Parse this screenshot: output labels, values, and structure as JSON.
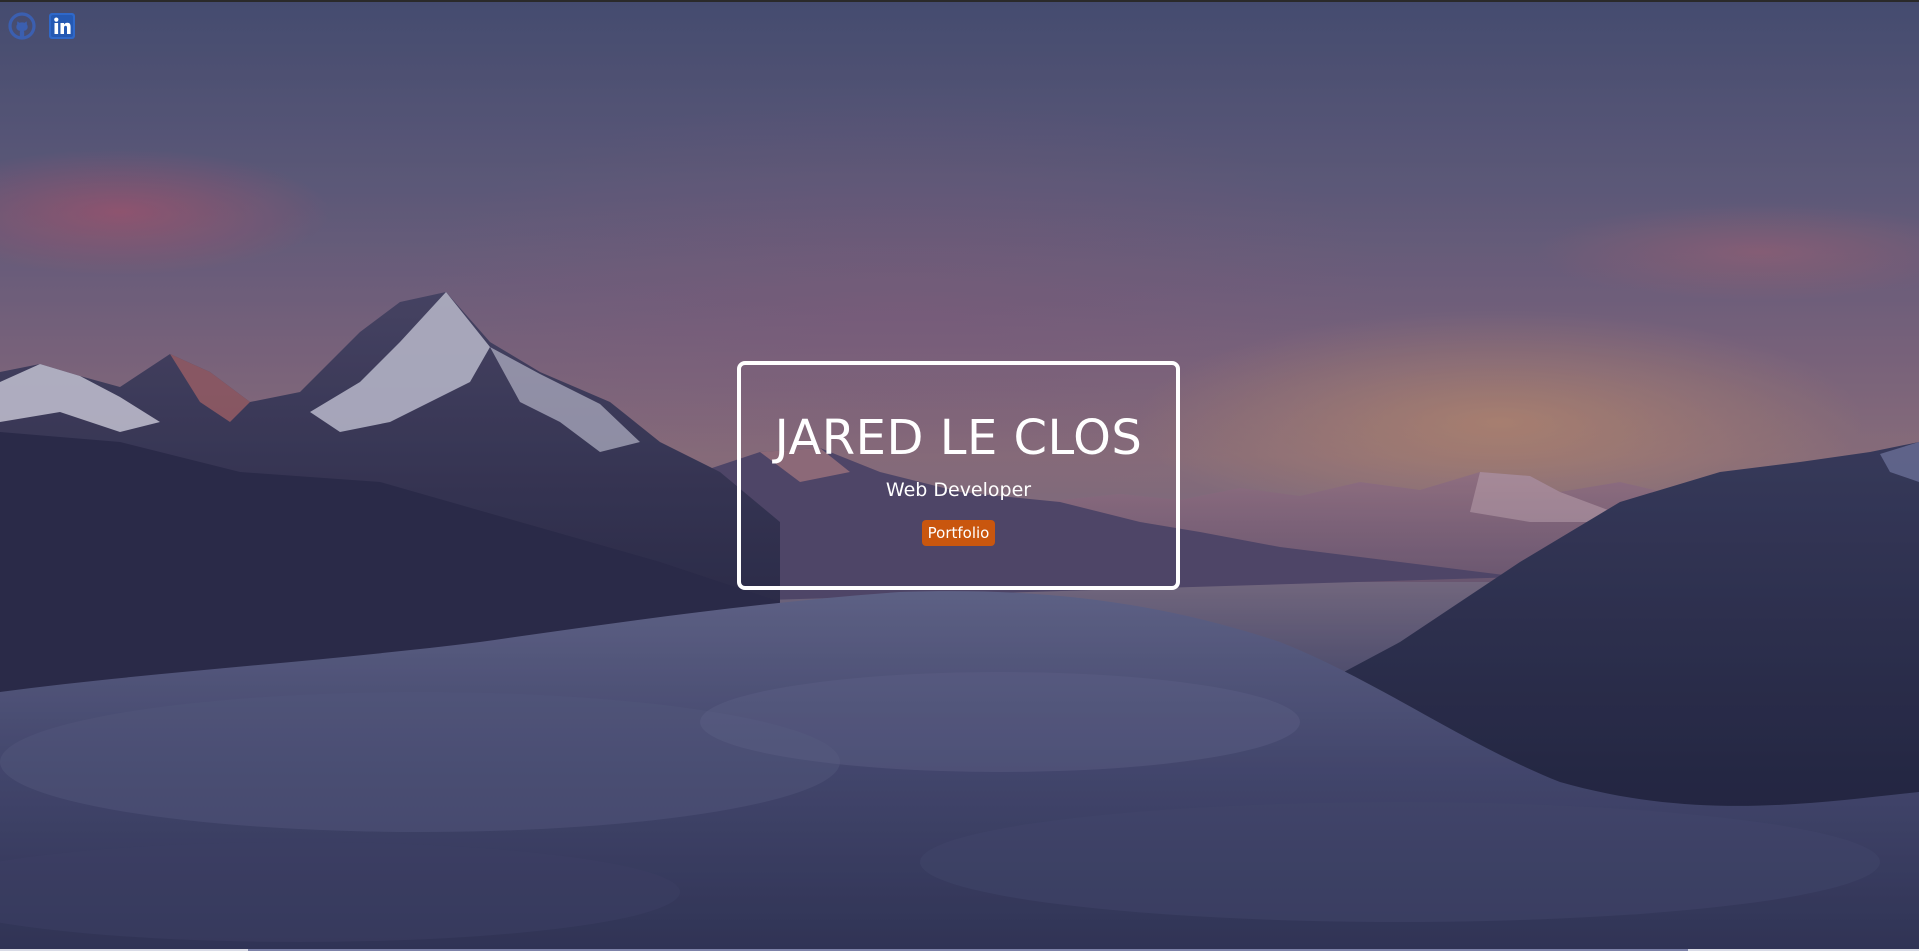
{
  "social": {
    "github": {
      "icon": "github-icon",
      "color": "#3b5fb0"
    },
    "linkedin": {
      "icon": "linkedin-icon",
      "label": "in",
      "color": "#2f68c9"
    }
  },
  "hero": {
    "name": "JARED LE CLOS",
    "role": "Web Developer",
    "button_label": "Portfolio",
    "button_color": "#c9560e",
    "border_color": "#ffffff"
  }
}
